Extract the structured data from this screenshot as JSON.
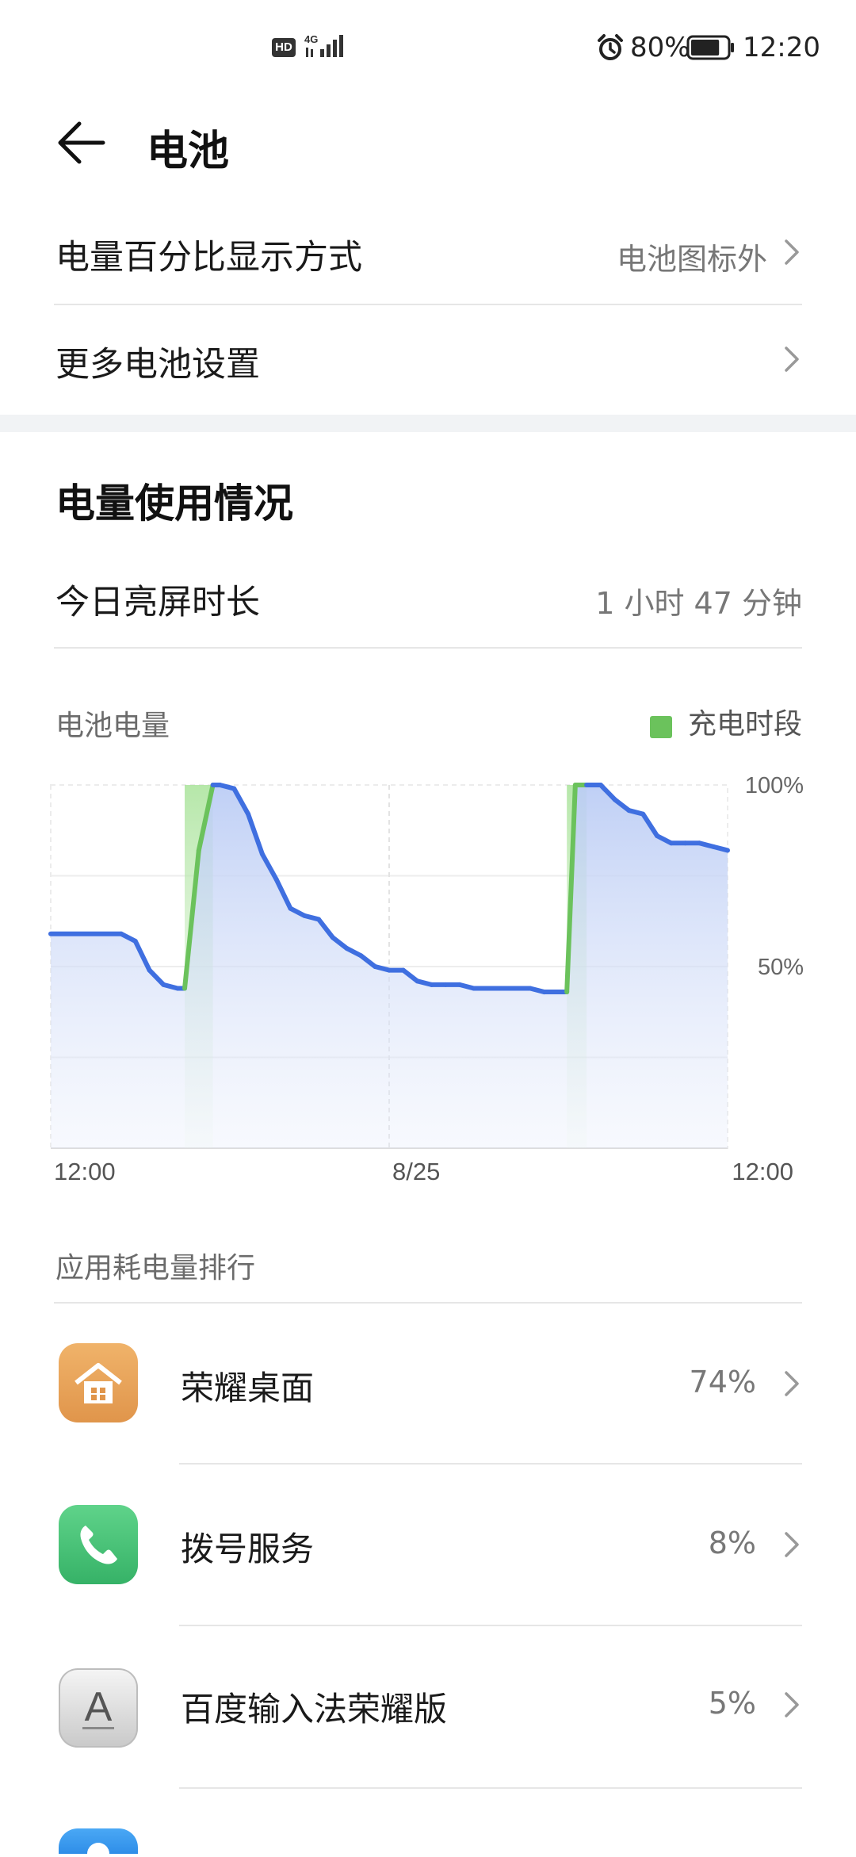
{
  "status_bar": {
    "hd_badge": "HD",
    "network": "4G",
    "battery_percent": "80%",
    "time": "12:20",
    "battery_level": 0.8
  },
  "header": {
    "title": "电池"
  },
  "settings": [
    {
      "label": "电量百分比显示方式",
      "value": "电池图标外"
    },
    {
      "label": "更多电池设置",
      "value": ""
    }
  ],
  "usage": {
    "title": "电量使用情况",
    "screen_time_label": "今日亮屏时长",
    "screen_time_value": "1 小时 47 分钟"
  },
  "battery_chart": {
    "label": "电池电量",
    "legend": "充电时段",
    "colors": {
      "line": "#3f6fe0",
      "charging": "#6bc25c",
      "fill": "#c9d6f7"
    }
  },
  "chart_data": {
    "type": "area",
    "xlabel": "",
    "ylabel": "",
    "x_tick_labels": [
      "12:00",
      "8/25",
      "12:00"
    ],
    "y_tick_labels": [
      "100%",
      "50%"
    ],
    "ylim": [
      0,
      100
    ],
    "xlim_hours": [
      0,
      48
    ],
    "series": [
      {
        "name": "电池电量",
        "x": [
          0,
          5,
          6,
          7,
          8,
          9,
          9.5,
          10.5,
          11.5,
          12,
          13,
          14,
          15,
          16,
          17,
          18,
          19,
          20,
          21,
          22,
          23,
          24,
          25,
          26,
          27,
          28,
          29,
          30,
          31,
          32,
          33,
          34,
          35,
          36,
          36.6,
          37.2,
          38,
          39,
          40,
          41,
          42,
          43,
          44,
          45,
          46,
          47,
          48
        ],
        "y": [
          59,
          59,
          57,
          49,
          45,
          44,
          44,
          82,
          100,
          100,
          99,
          92,
          81,
          74,
          66,
          64,
          63,
          58,
          55,
          53,
          50,
          49,
          49,
          46,
          45,
          45,
          45,
          44,
          44,
          44,
          44,
          44,
          43,
          43,
          43,
          100,
          100,
          100,
          96,
          93,
          92,
          86,
          84,
          84,
          84,
          83,
          82
        ]
      }
    ],
    "charging_periods_hours": [
      [
        9.5,
        11.5
      ],
      [
        36.6,
        38
      ]
    ]
  },
  "ranking": {
    "title": "应用耗电量排行",
    "apps": [
      {
        "name": "荣耀桌面",
        "percent": "74%",
        "icon": "home-app-icon",
        "color": "#e8a259"
      },
      {
        "name": "拨号服务",
        "percent": "8%",
        "icon": "phone-app-icon",
        "color": "#4fc47a"
      },
      {
        "name": "百度输入法荣耀版",
        "percent": "5%",
        "icon": "keyboard-app-icon",
        "color": "#d9d9d9"
      }
    ]
  }
}
